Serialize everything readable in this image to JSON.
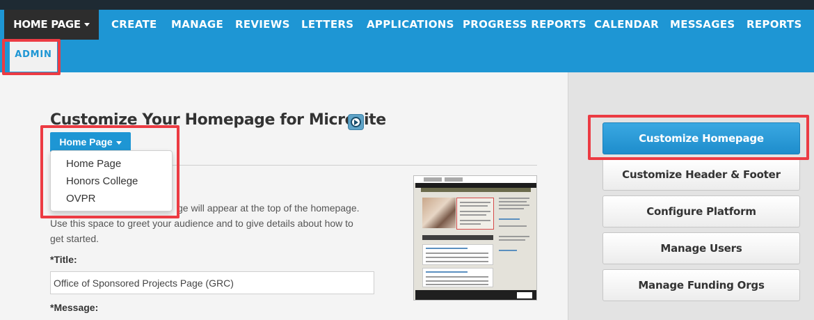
{
  "nav": {
    "home_label": "HOME PAGE",
    "items": [
      "CREATE",
      "MANAGE",
      "REVIEWS",
      "LETTERS",
      "APPLICATIONS",
      "PROGRESS REPORTS",
      "CALENDAR",
      "MESSAGES",
      "REPORTS"
    ],
    "admin_label": "ADMIN"
  },
  "page": {
    "title": "Customize Your Homepage for Microsite",
    "dropdown_label": "Home Page",
    "dropdown_options": [
      "Home Page",
      "Honors College",
      "OVPR"
    ],
    "description_line1": "ge will appear at the top of the homepage.",
    "description_line2": "Use this space to greet your audience and to give details about how to",
    "description_line3": "get started.",
    "title_label": "*Title:",
    "title_value": "Office of Sponsored Projects Page (GRC)",
    "message_label": "*Message:"
  },
  "sidebar": {
    "buttons": [
      "Customize Homepage",
      "Customize Header & Footer",
      "Configure Platform",
      "Manage Users",
      "Manage Funding Orgs"
    ]
  },
  "colors": {
    "nav_blue": "#1e96d4",
    "nav_dark": "#2d2d2d",
    "highlight_red": "#ec3b43",
    "active_button": "#1e8dcc"
  }
}
